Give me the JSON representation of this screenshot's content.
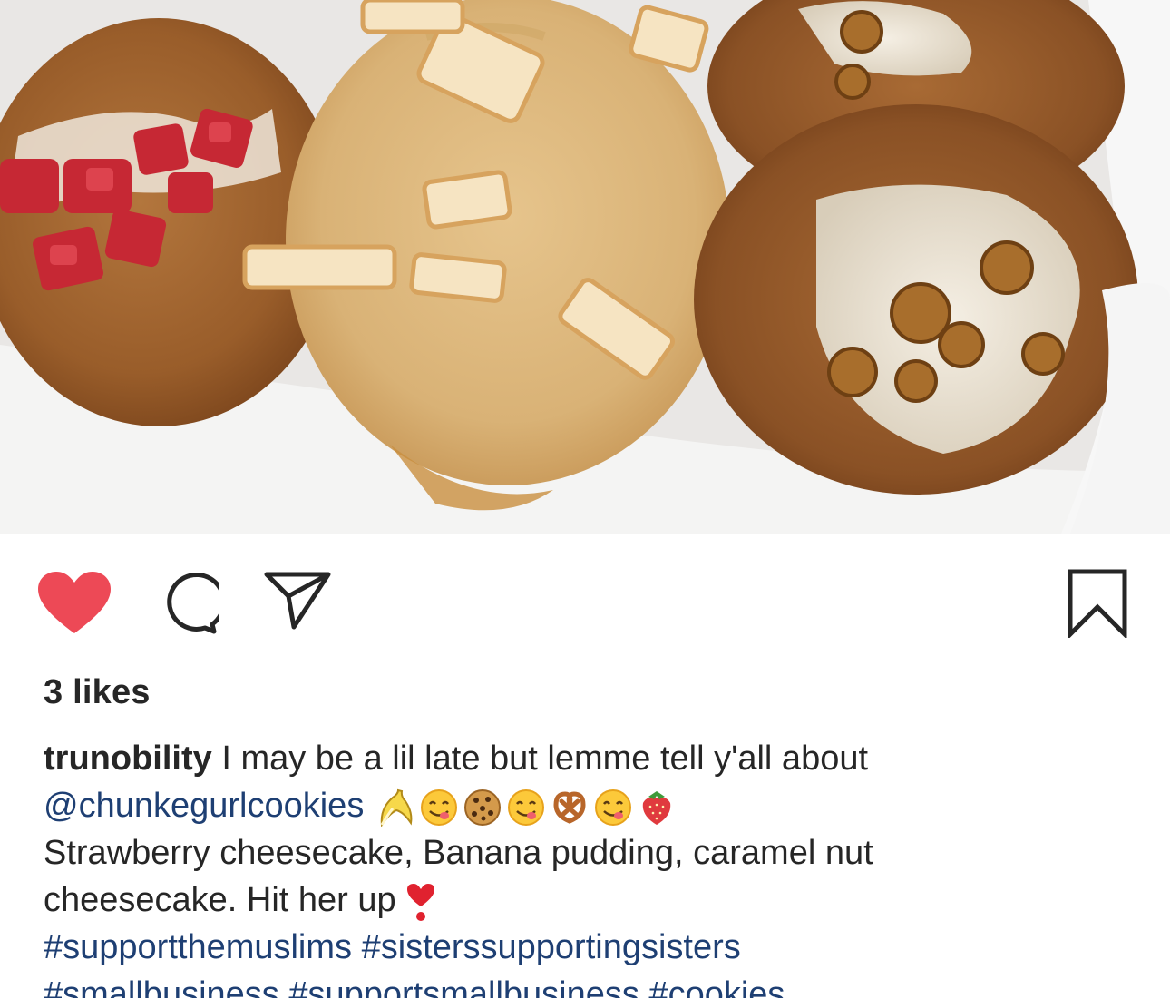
{
  "post": {
    "image_alt_icon": "cookies-photo",
    "likes_text": "3 likes",
    "username": "trunobility",
    "caption_line1": " I may be a lil late but lemme tell y'all about",
    "mention": "@chunkegurlcookies",
    "emojis": [
      "banana",
      "yum-face",
      "cookie",
      "yum-face",
      "pretzel",
      "yum-face",
      "strawberry"
    ],
    "caption_line3": "Strawberry cheesecake, Banana pudding, caramel nut",
    "caption_line4": "cheesecake. Hit her up",
    "caption_line4_emoji": "heart-exclamation",
    "hashtags_line1": "#supportthemuslims #sisterssupportingsisters",
    "hashtags_line2": "#smallbusiness #supportsmallbusiness #cookies"
  },
  "colors": {
    "heart": "#ed4956",
    "text": "#262626",
    "link": "#1e3f73"
  },
  "icons": {
    "like": "heart-icon",
    "comment": "comment-icon",
    "share": "share-icon",
    "save": "bookmark-icon"
  }
}
